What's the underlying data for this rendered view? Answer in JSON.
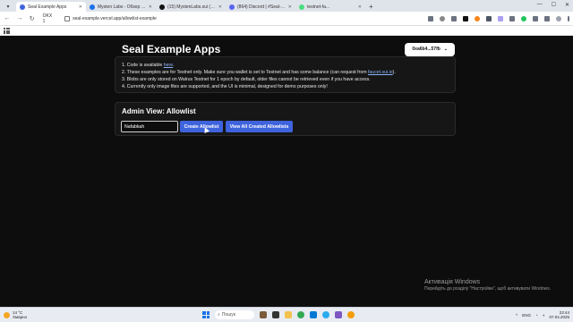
{
  "browser": {
    "tabs": [
      {
        "title": "Seal Example Apps",
        "active": true,
        "color": "#3e63dd"
      },
      {
        "title": "Mysten Labs - Обзор инвести...",
        "active": false,
        "color": "#1a73e8"
      },
      {
        "title": "(15) MystenLabs.sui (@Mysten...",
        "active": false,
        "color": "#111111"
      },
      {
        "title": "(864) Discord | #Seal-testn...",
        "active": false,
        "color": "#5865f2"
      },
      {
        "title": "testnet-fa...",
        "active": false,
        "color": "#4ade80"
      }
    ],
    "okx_label": "OKX 1",
    "url": "seal-example.vercel.app/allowlist-example"
  },
  "header": {
    "title": "Seal Example Apps",
    "wallet_address": "0xa6b4...57fb",
    "wallet_chevron": "⌄"
  },
  "info": {
    "line1_prefix": "1. Code is available ",
    "line1_link": "here",
    "line1_suffix": ".",
    "line2_prefix": "2. These examples are for Testnet only. Make sure you wallet is set to Testnet and has some balance (can request from ",
    "line2_link": "faucet.sui.io",
    "line2_suffix": ").",
    "line3": "3. Blobs are only stored on Walrus Testnet for 1 epoch by default, older files cannot be retrieved even if you have access.",
    "line4": "4. Currently only image files are supported, and the UI is minimal, designed for demo purposes only!"
  },
  "admin": {
    "title": "Admin View: Allowlist",
    "input_value": "Nafabkah",
    "create_label": "Create Allowlist",
    "view_label": "View All Created Allowlists",
    "accent_color": "#3e63dd"
  },
  "watermark": {
    "title": "Активація Windows",
    "subtitle": "Перейдіть до розділу \"Настройки\", щоб активувати Windows."
  },
  "taskbar": {
    "weather_temp": "14 °C",
    "weather_desc": "Хмарно",
    "search_placeholder": "Пошук",
    "lang": "ENG",
    "time": "23:44",
    "date": "07.04.2025"
  }
}
